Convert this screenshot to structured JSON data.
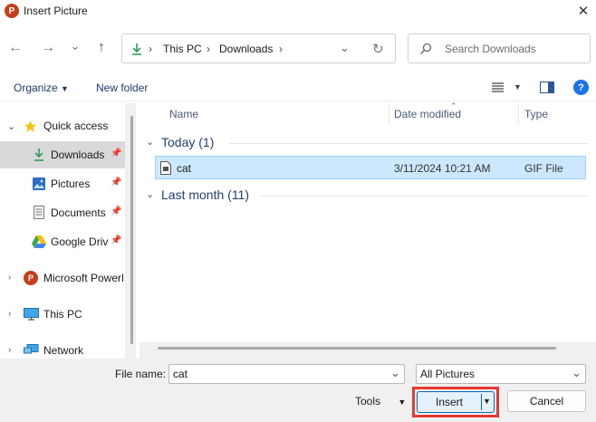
{
  "window": {
    "title": "Insert Picture",
    "close_glyph": "✕",
    "app_icon_letter": "P"
  },
  "nav": {
    "back_glyph": "←",
    "forward_glyph": "→",
    "recent_glyph": "⌄",
    "up_glyph": "↑",
    "refresh_glyph": "↻",
    "breadcrumb": [
      "This PC",
      "Downloads"
    ],
    "search_placeholder": "Search Downloads"
  },
  "toolbar": {
    "organize_label": "Organize",
    "new_folder_label": "New folder",
    "help_glyph": "?"
  },
  "sidebar": {
    "items": [
      {
        "label": "Quick access",
        "icon": "star-icon"
      },
      {
        "label": "Downloads",
        "icon": "download-arrow-icon"
      },
      {
        "label": "Pictures",
        "icon": "pictures-icon"
      },
      {
        "label": "Documents",
        "icon": "documents-icon"
      },
      {
        "label": "Google Drive",
        "icon": "google-drive-icon"
      },
      {
        "label": "Microsoft PowerPoint",
        "icon": "powerpoint-icon"
      },
      {
        "label": "This PC",
        "icon": "monitor-icon"
      },
      {
        "label": "Network",
        "icon": "network-icon"
      }
    ]
  },
  "columns": {
    "name": "Name",
    "date_modified": "Date modified",
    "type": "Type"
  },
  "groups": [
    {
      "label": "Today (1)"
    },
    {
      "label": "Last month (11)"
    }
  ],
  "files": [
    {
      "name": "cat",
      "date": "3/11/2024 10:21 AM",
      "type": "GIF File"
    }
  ],
  "footer": {
    "file_name_label": "File name:",
    "file_name_value": "cat",
    "filter_value": "All Pictures",
    "tools_label": "Tools",
    "insert_label": "Insert",
    "cancel_label": "Cancel"
  },
  "colors": {
    "selection_bg": "#cce8ff",
    "selection_border": "#99d1ff",
    "highlight_red": "#e53935",
    "insert_button_bg": "#e5f1fb",
    "insert_button_border": "#0067c0",
    "help_blue": "#1a73e8"
  }
}
